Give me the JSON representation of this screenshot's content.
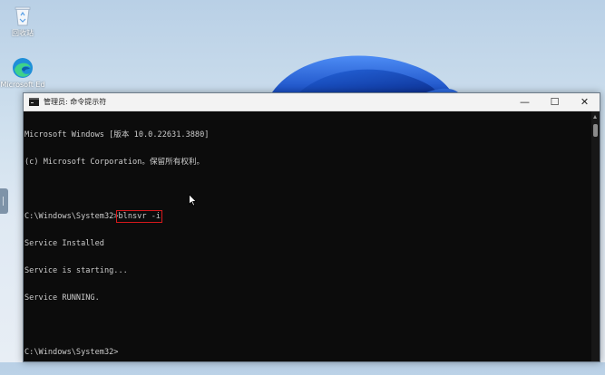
{
  "desktop": {
    "icons": [
      {
        "label": "回收站",
        "icon": "recycle-bin-icon"
      },
      {
        "label": "Microsoft Ed",
        "icon": "edge-icon"
      }
    ]
  },
  "window": {
    "title": "管理员: 命令提示符",
    "buttons": {
      "minimize": "—",
      "maximize": "☐",
      "close": "✕"
    }
  },
  "console": {
    "lines": [
      "Microsoft Windows [版本 10.0.22631.3880]",
      "(c) Microsoft Corporation。保留所有权利。",
      "",
      "C:\\Windows\\System32>",
      "Service Installed",
      "Service is starting...",
      "Service RUNNING.",
      "",
      "C:\\Windows\\System32>"
    ],
    "highlighted_command": "blnsvr -i"
  },
  "colors": {
    "console_bg": "#0c0c0c",
    "console_text": "#cccccc",
    "highlight": "#d7191c",
    "accent": "#0067c0"
  }
}
